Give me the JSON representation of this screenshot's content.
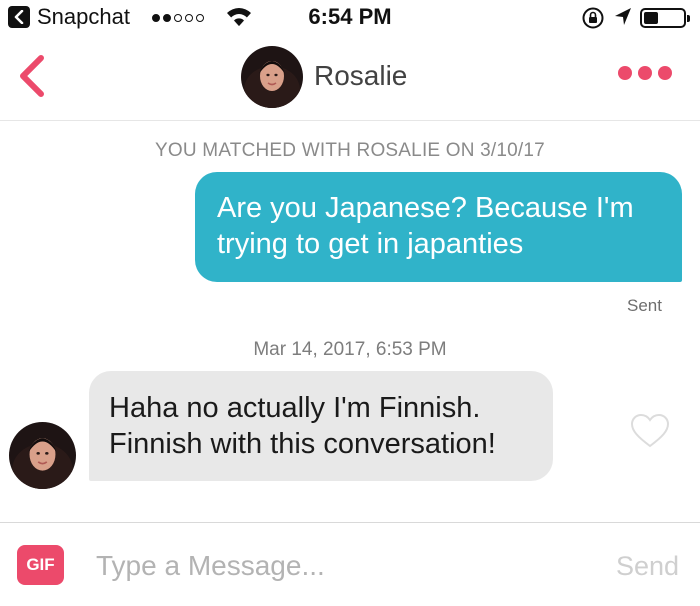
{
  "status_bar": {
    "app": "Snapchat",
    "time": "6:54 PM",
    "signal_bars_filled": 2,
    "signal_bars_total": 5,
    "battery_level": 0.3
  },
  "header": {
    "contact_name": "Rosalie",
    "accent_color": "#ec4a6b"
  },
  "chat": {
    "match_notice": "YOU MATCHED WITH ROSALIE ON 3/10/17",
    "messages": [
      {
        "direction": "sent",
        "text": "Are you Japanese? Because I'm trying to get in japanties",
        "status": "Sent"
      },
      {
        "direction": "received",
        "timestamp": "Mar 14, 2017, 6:53 PM",
        "text": "Haha no actually I'm Finnish. Finnish with this conversation!"
      }
    ],
    "sent_bubble_color": "#30b3c9",
    "received_bubble_color": "#e8e8e8"
  },
  "composer": {
    "gif_label": "GIF",
    "placeholder": "Type a Message...",
    "value": "",
    "send_label": "Send"
  }
}
